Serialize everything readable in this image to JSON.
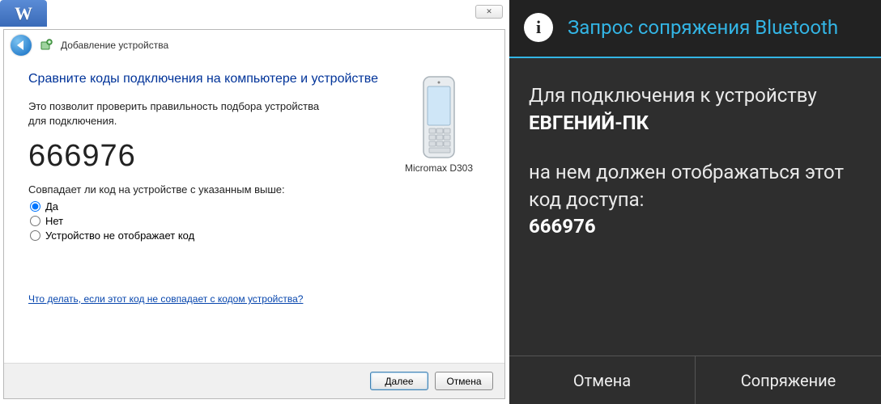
{
  "left": {
    "word_letter": "W",
    "dialog_title": "Добавление устройства",
    "heading": "Сравните коды подключения на компьютере и устройстве",
    "description": "Это позволит проверить правильность подбора устройства для подключения.",
    "pairing_code": "666976",
    "prompt": "Совпадает ли код на устройстве с указанным выше:",
    "radio_yes": "Да",
    "radio_no": "Нет",
    "radio_nocode": "Устройство не отображает код",
    "device_name": "Micromax D303",
    "help_link": "Что делать, если этот код не совпадает с кодом устройства?",
    "btn_next": "Далее",
    "btn_cancel": "Отмена"
  },
  "right": {
    "title": "Запрос сопряжения Bluetooth",
    "line1_pre": "Для подключения к устройству",
    "device_name": "ЕВГЕНИЙ-ПК",
    "line2_pre": "на нем должен отображаться этот код доступа:",
    "pairing_code": "666976",
    "btn_cancel": "Отмена",
    "btn_pair": "Сопряжение"
  }
}
